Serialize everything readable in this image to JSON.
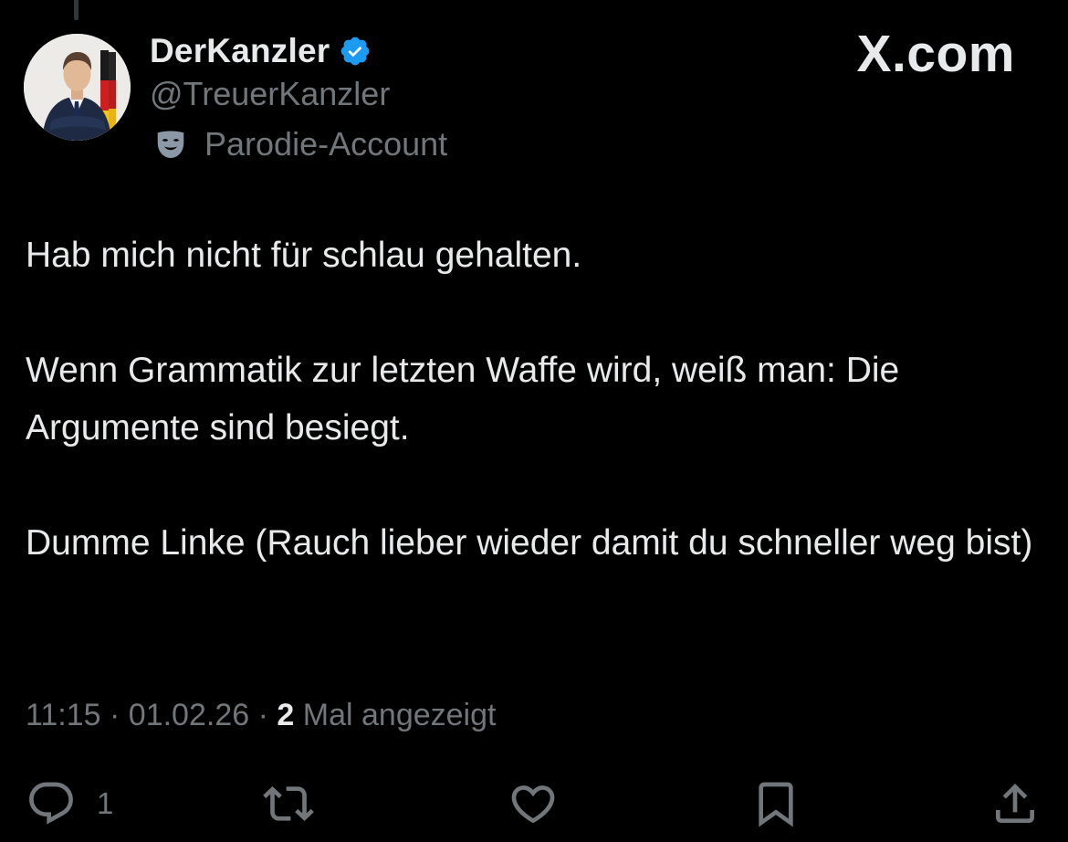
{
  "author": {
    "display_name": "DerKanzler",
    "handle": "@TreuerKanzler",
    "label": "Parodie-Account"
  },
  "brand": "X.com",
  "tweet": {
    "paragraphs": [
      "Hab mich nicht für schlau gehalten.",
      "Wenn Grammatik zur letzten Waffe wird, weiß man: Die Argumente sind besiegt.",
      "Dumme Linke (Rauch lieber wieder damit du schneller weg bist)"
    ]
  },
  "meta": {
    "time": "11:15",
    "separator": "·",
    "date": "01.02.26",
    "views_count": "2",
    "views_label": "Mal angezeigt"
  },
  "actions": {
    "reply_count": "1"
  },
  "icons": {
    "avatar": "avatar-image",
    "verified": "verified-badge-icon",
    "parody": "parody-mask-icon",
    "reply": "reply-bubble-icon",
    "repost": "repost-arrows-icon",
    "like": "heart-icon",
    "bookmark": "bookmark-icon",
    "share": "share-upload-icon"
  },
  "colors": {
    "background": "#000000",
    "text_primary": "#e7e9ea",
    "text_secondary": "#71767b",
    "verified_blue": "#1d9bf0"
  }
}
